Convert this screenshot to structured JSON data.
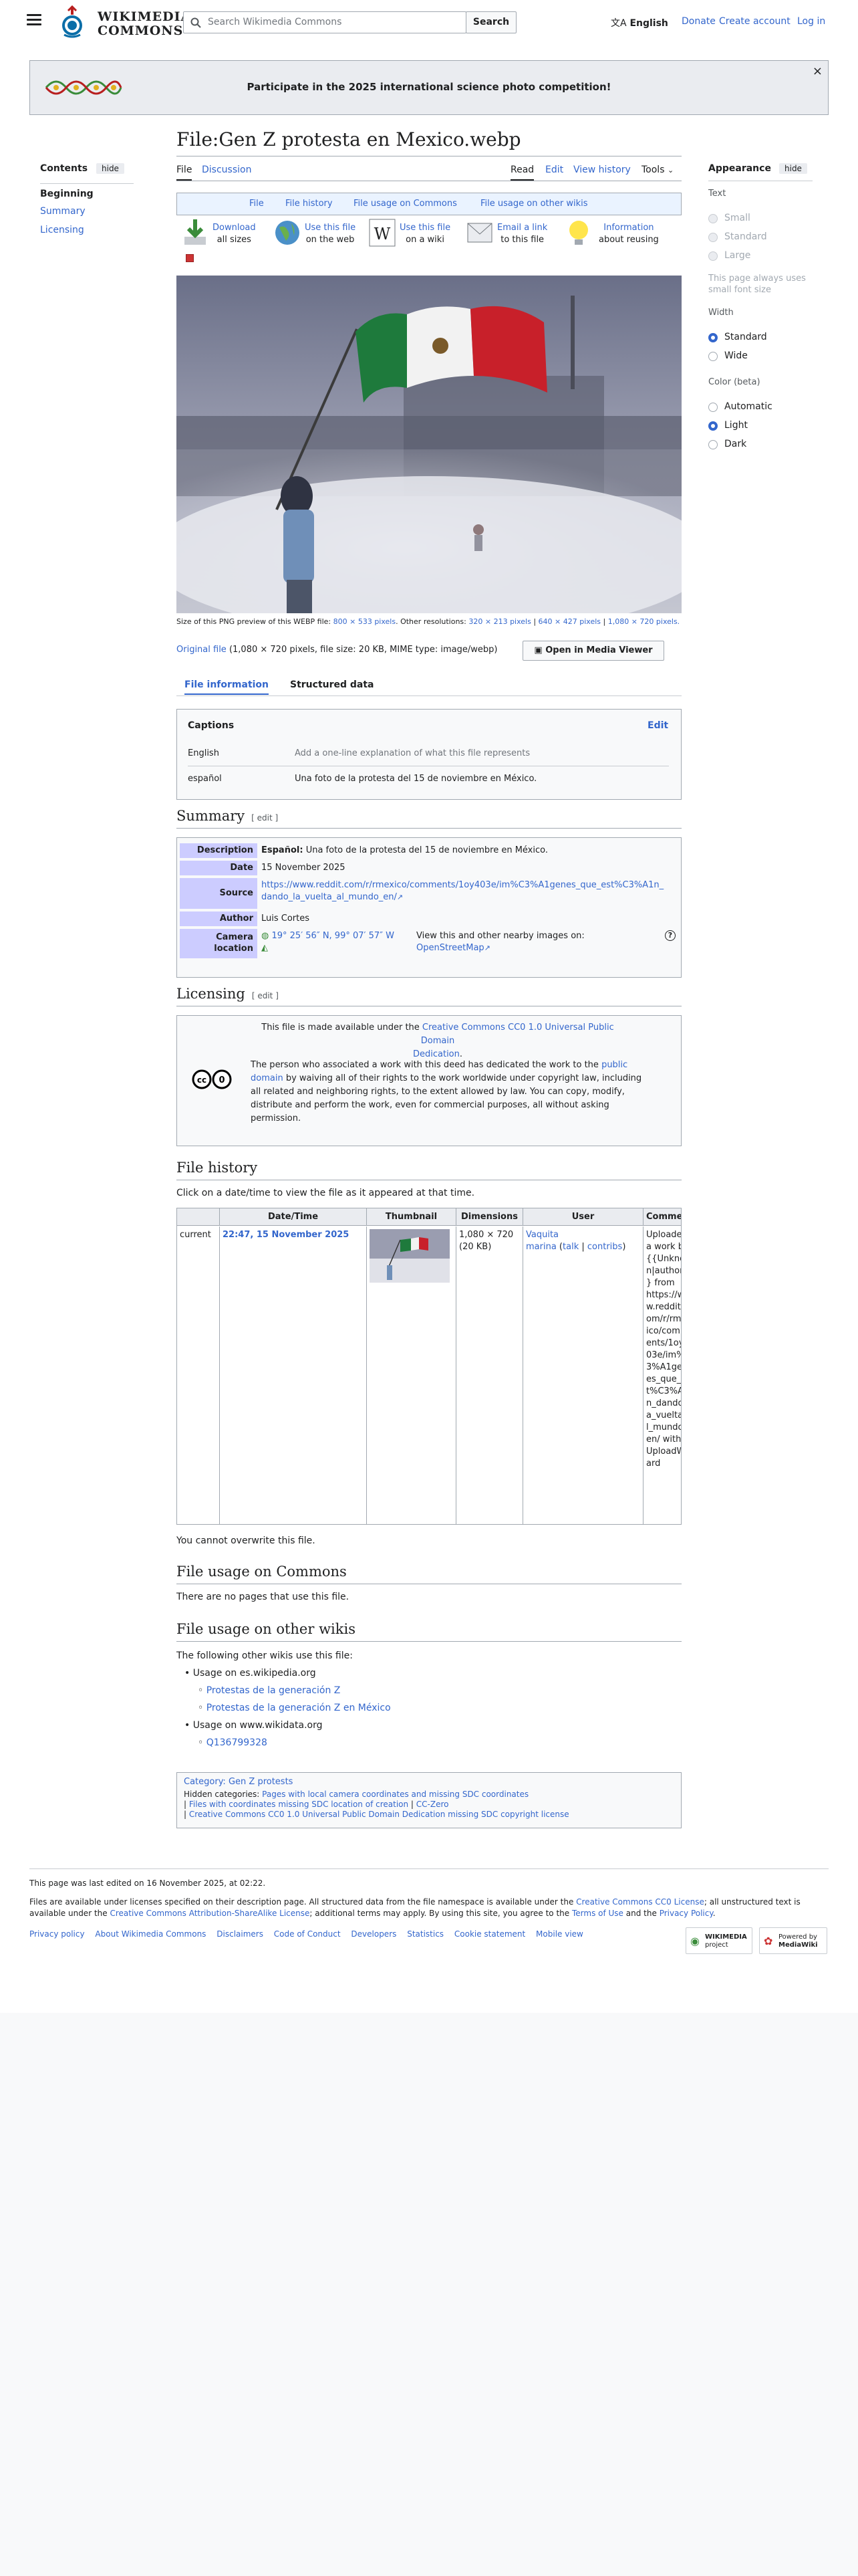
{
  "header": {
    "logo_line1": "WIKIMEDIA",
    "logo_line2": "COMMONS",
    "search_placeholder": "Search Wikimedia Commons",
    "search_button": "Search",
    "language": "English",
    "donate": "Donate",
    "create_account": "Create account",
    "login": "Log in"
  },
  "banner": {
    "text": "Participate in the 2025 international science photo competition!",
    "close": "×"
  },
  "toc": {
    "title": "Contents",
    "hide": "hide",
    "items": [
      "Beginning",
      "Summary",
      "Licensing"
    ]
  },
  "page": {
    "title": "File:Gen Z protesta en Mexico.webp",
    "tab_file": "File",
    "tab_discussion": "Discussion",
    "tab_read": "Read",
    "tab_edit": "Edit",
    "tab_history": "View history",
    "tab_tools": "Tools"
  },
  "subnav": [
    "File",
    "File history",
    "File usage on Commons",
    "File usage on other wikis"
  ],
  "tools": [
    {
      "l1": "Download",
      "l2": "all sizes"
    },
    {
      "l1": "Use this file",
      "l2": "on the web"
    },
    {
      "l1": "Use this file",
      "l2": "on a wiki"
    },
    {
      "l1": "Email a link",
      "l2": "to this file"
    },
    {
      "l1": "Information",
      "l2": "about reusing"
    }
  ],
  "preview": {
    "size_text": "Size of this PNG preview of this WEBP file:",
    "size_link": "800 × 533 pixels",
    "other_res": ". Other resolutions:",
    "res1": "320 × 213 pixels",
    "res2": "640 × 427 pixels",
    "res3": "1,080 × 720 pixels.",
    "original_link": "Original file",
    "original_info": "(1,080 × 720 pixels, file size: 20 KB, MIME type: image/webp)",
    "media_viewer": "Open in Media Viewer"
  },
  "info_tabs": [
    "File information",
    "Structured data"
  ],
  "captions": {
    "title": "Captions",
    "edit": "Edit",
    "rows": [
      {
        "lang": "English",
        "text": "Add a one-line explanation of what this file represents"
      },
      {
        "lang": "español",
        "text": "Una foto de la protesta del 15 de noviembre en México."
      }
    ]
  },
  "summary": {
    "heading": "Summary",
    "edit": "[ edit ]",
    "description_label": "Description",
    "description_lang": "Español:",
    "description": "Una foto de la protesta del 15 de noviembre en México.",
    "date_label": "Date",
    "date": "15 November 2025",
    "source_label": "Source",
    "source_line1": "https://www.reddit.com/r/rmexico/comments/1oy403e/im%C3%A1genes_que_est%C3%A1n_",
    "source_line2": "dando_la_vuelta_al_mundo_en/",
    "author_label": "Author",
    "author": "Luis Cortes",
    "camera_label1": "Camera",
    "camera_label2": "location",
    "camera_coords": "19° 25′ 56″ N, 99° 07′ 57″ W",
    "nearby": "View this and other nearby images on:",
    "osm": "OpenStreetMap"
  },
  "licensing": {
    "heading": "Licensing",
    "edit": "[ edit ]",
    "line1_a": "This file is made available under the",
    "line1_link": "Creative Commons CC0 1.0 Universal Public Domain",
    "line1_link2": "Dedication",
    "p1": "The person who associated a work with this deed has dedicated the work to the",
    "pd_link1": "public",
    "pd_link2": "domain",
    "p2": "by waiving all of their rights to the work worldwide under copyright law, including",
    "p3": "all related and neighboring rights, to the extent allowed by law. You can copy, modify,",
    "p4": "distribute and perform the work, even for commercial purposes, all without asking",
    "p5": "permission."
  },
  "history": {
    "heading": "File history",
    "intro": "Click on a date/time to view the file as it appeared at that time.",
    "headers": [
      "Date/Time",
      "Thumbnail",
      "Dimensions",
      "User",
      "Comment"
    ],
    "current": "current",
    "datetime": "22:47, 15 November 2025",
    "dims1": "1,080 × 720",
    "dims2": "(20 KB)",
    "user1": "Vaquita",
    "user2": "marina",
    "talk": "talk",
    "contribs": "contribs",
    "comment_lines": [
      "Uploaded",
      "a work b",
      "{{Unkno",
      "n|author",
      "} from",
      "https://w",
      "w.reddit.",
      "om/r/rme",
      "ico/comm",
      "ents/1oy",
      "03e/im%",
      "3%A1gen",
      "es_que_e",
      "t%C3%A",
      "n_dando_",
      "a_vuelta_",
      "l_mundo_",
      "en/ with",
      "UploadW",
      "ard"
    ],
    "no_overwrite": "You cannot overwrite this file."
  },
  "usage_commons": {
    "heading": "File usage on Commons",
    "text": "There are no pages that use this file."
  },
  "usage_other": {
    "heading": "File usage on other wikis",
    "intro": "The following other wikis use this file:",
    "wiki1": "Usage on es.wikipedia.org",
    "wiki1_pages": [
      "Protestas de la generación Z",
      "Protestas de la generación Z en México"
    ],
    "wiki2": "Usage on www.wikidata.org",
    "wiki2_pages": [
      "Q136799328"
    ]
  },
  "categories": {
    "label": "Category:",
    "cat": "Gen Z protests",
    "hidden_label": "Hidden categories:",
    "hidden": [
      "Pages with local camera coordinates and missing SDC coordinates",
      "Files with coordinates missing SDC location of creation",
      "CC-Zero",
      "Creative Commons CC0 1.0 Universal Public Domain Dedication missing SDC copyright license"
    ]
  },
  "appearance": {
    "title": "Appearance",
    "hide": "hide",
    "text_label": "Text",
    "text_opts": [
      "Small",
      "Standard",
      "Large"
    ],
    "text_note1": "This page always uses",
    "text_note2": "small font size",
    "width_label": "Width",
    "width_opts": [
      "Standard",
      "Wide"
    ],
    "color_label": "Color (beta)",
    "color_opts": [
      "Automatic",
      "Light",
      "Dark"
    ]
  },
  "footer": {
    "edited": "This page was last edited on 16 November 2025, at 02:22.",
    "l1a": "Files are available under licenses specified on their description page. All structured data from the file namespace is available under the",
    "l1link": "Creative Commons CC0 License",
    "l1b": "; all unstructured text is",
    "l2a": "available under the",
    "l2link": "Creative Commons Attribution-ShareAlike License",
    "l2b": "; additional terms may apply. By using this site, you agree to the",
    "terms": "Terms of Use",
    "and": "and the",
    "privacy": "Privacy Policy",
    "links": [
      "Privacy policy",
      "About Wikimedia Commons",
      "Disclaimers",
      "Code of Conduct",
      "Developers",
      "Statistics",
      "Cookie statement",
      "Mobile view"
    ],
    "badge1a": "WIKIMEDIA",
    "badge1b": "project",
    "badge2a": "Powered by",
    "badge2b": "MediaWiki"
  },
  "colors": {
    "link": "#3366cc",
    "label_bg": "#ccccff",
    "subnav_bg": "#eaf3ff"
  }
}
